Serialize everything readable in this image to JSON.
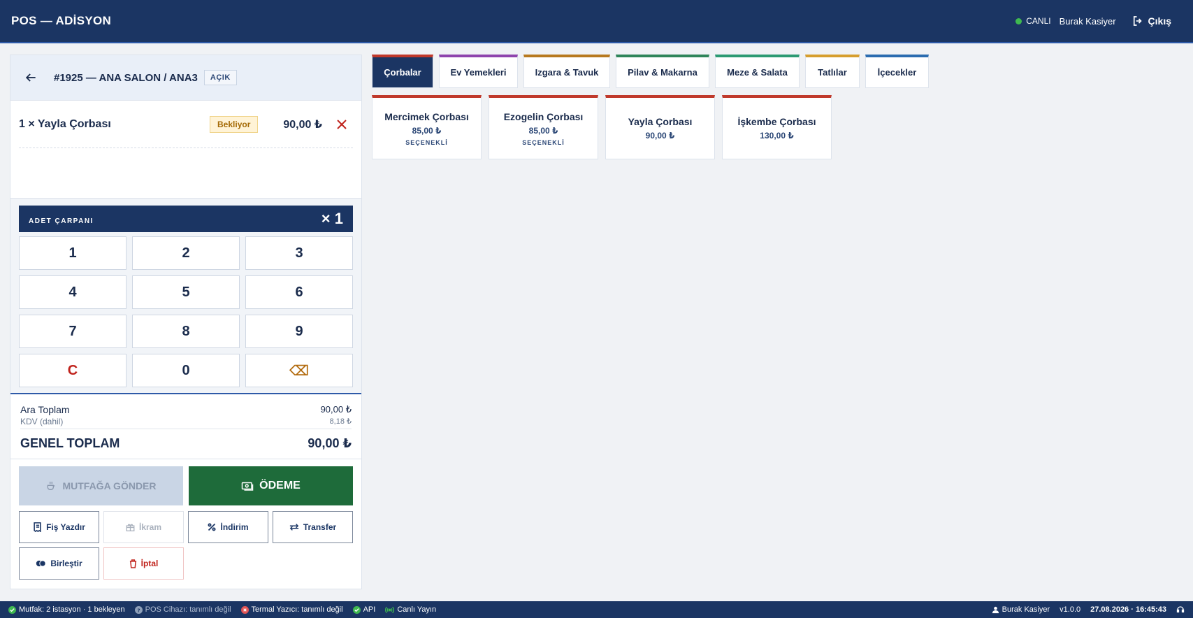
{
  "header": {
    "title": "POS — ADİSYON",
    "status": "CANLI",
    "user": "Burak Kasiyer",
    "logout_label": "Çıkış"
  },
  "order": {
    "title": "#1925 — ANA SALON / ANA3",
    "status_badge": "AÇIK",
    "items": [
      {
        "name": "1 × Yayla Çorbası",
        "status": "Bekliyor",
        "price": "90,00 ₺"
      }
    ]
  },
  "keypad": {
    "multiplier_label": "ADET ÇARPANI",
    "multiplier_value": "× 1",
    "keys": [
      "1",
      "2",
      "3",
      "4",
      "5",
      "6",
      "7",
      "8",
      "9",
      "C",
      "0",
      "⌫"
    ]
  },
  "totals": {
    "subtotal_label": "Ara Toplam",
    "subtotal_value": "90,00 ₺",
    "vat_label": "KDV (dahil)",
    "vat_value": "8,18 ₺",
    "grand_label": "GENEL TOPLAM",
    "grand_value": "90,00 ₺"
  },
  "actions": {
    "kitchen_label": "MUTFAĞA GÖNDER",
    "pay_label": "ÖDEME",
    "print_label": "Fiş Yazdır",
    "treat_label": "İkram",
    "discount_label": "İndirim",
    "transfer_label": "Transfer",
    "merge_label": "Birleştir",
    "cancel_label": "İptal"
  },
  "categories": [
    {
      "label": "Çorbalar",
      "color": "#c0392b",
      "active": true
    },
    {
      "label": "Ev Yemekleri",
      "color": "#8e44ad",
      "active": false
    },
    {
      "label": "Izgara & Tavuk",
      "color": "#b7791f",
      "active": false
    },
    {
      "label": "Pilav & Makarna",
      "color": "#2f855a",
      "active": false
    },
    {
      "label": "Meze & Salata",
      "color": "#2c9a73",
      "active": false
    },
    {
      "label": "Tatlılar",
      "color": "#d69e2e",
      "active": false
    },
    {
      "label": "İçecekler",
      "color": "#2b6cb0",
      "active": false
    }
  ],
  "products": [
    {
      "name": "Mercimek Çorbası",
      "price": "85,00 ₺",
      "tag": "SEÇENEKLİ"
    },
    {
      "name": "Ezogelin Çorbası",
      "price": "85,00 ₺",
      "tag": "SEÇENEKLİ"
    },
    {
      "name": "Yayla Çorbası",
      "price": "90,00 ₺",
      "tag": ""
    },
    {
      "name": "İşkembe Çorbası",
      "price": "130,00 ₺",
      "tag": ""
    }
  ],
  "statusbar": {
    "kitchen": "Mutfak: 2 istasyon · 1 bekleyen",
    "pos_device": "POS Cihazı: tanımlı değil",
    "printer": "Termal Yazıcı: tanımlı değil",
    "api": "API",
    "live": "Canlı Yayın",
    "user": "Burak Kasiyer",
    "version": "v1.0.0",
    "datetime": "27.08.2026 · 16:45:43"
  },
  "colors": {
    "primary": "#1b3563",
    "success": "#1e6b3a",
    "danger": "#c0231c",
    "live_dot": "#3fb950"
  }
}
